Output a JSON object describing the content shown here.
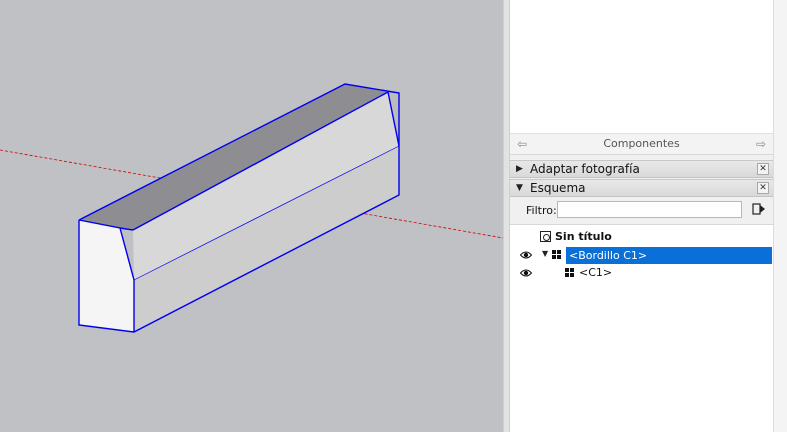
{
  "viewport": {
    "background": "#c0c1c5",
    "selection_color": "#0000ff",
    "axis_color": "#cc0000"
  },
  "tray": {
    "components_panel": {
      "title": "Componentes",
      "back_icon": "arrow-left-icon",
      "forward_icon": "arrow-right-icon"
    },
    "sections": [
      {
        "label": "Adaptar fotografía",
        "expanded": false
      },
      {
        "label": "Esquema",
        "expanded": true
      }
    ],
    "outliner": {
      "filter_label": "Filtro:",
      "filter_value": "",
      "tree": [
        {
          "label": "Sin título",
          "type": "model",
          "bold": true
        },
        {
          "label": "<Bordillo C1>",
          "type": "component",
          "selected": true,
          "visible": true,
          "expanded": true
        },
        {
          "label": "<C1>",
          "type": "component",
          "selected": false,
          "visible": true
        }
      ]
    }
  }
}
